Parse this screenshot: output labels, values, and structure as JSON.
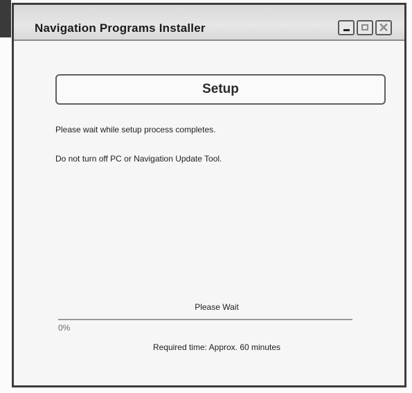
{
  "window": {
    "title": "Navigation Programs Installer",
    "controls": {
      "minimize": "minimize-icon",
      "maximize": "maximize-icon",
      "close": "close-icon",
      "close_glyph": "✕"
    }
  },
  "main": {
    "header_label": "Setup",
    "message_1": "Please wait while setup process completes.",
    "message_2": "Do not turn off PC or Navigation Update Tool.",
    "status": "Please Wait",
    "progress": {
      "value_percent": 0,
      "label": "0%"
    },
    "required_time": "Required time: Approx. 60 minutes"
  },
  "colors": {
    "border": "#3c3c3c",
    "background": "#f6f6f6",
    "text": "#1d1d1d"
  }
}
